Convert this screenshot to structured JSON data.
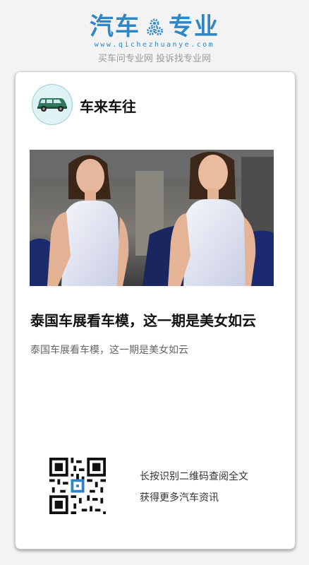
{
  "brand": {
    "logo_left": "汽车",
    "logo_right": "专业",
    "logo_icon": "gear-icon",
    "url": "www.qichezhuanye.com",
    "slogan": "买车问专业网 投诉找专业网",
    "color": "#2f86c6"
  },
  "card": {
    "author": {
      "name": "车来车往",
      "avatar_icon": "car-icon"
    },
    "image": {
      "description_icon": "photo"
    },
    "title": "泰国车展看车模，这一期是美女如云",
    "summary": "泰国车展看车模，这一期是美女如云",
    "qr": {
      "icon": "qr-code-icon",
      "line1": "长按识别二维码查阅全文",
      "line2": "获得更多汽车资讯"
    }
  }
}
